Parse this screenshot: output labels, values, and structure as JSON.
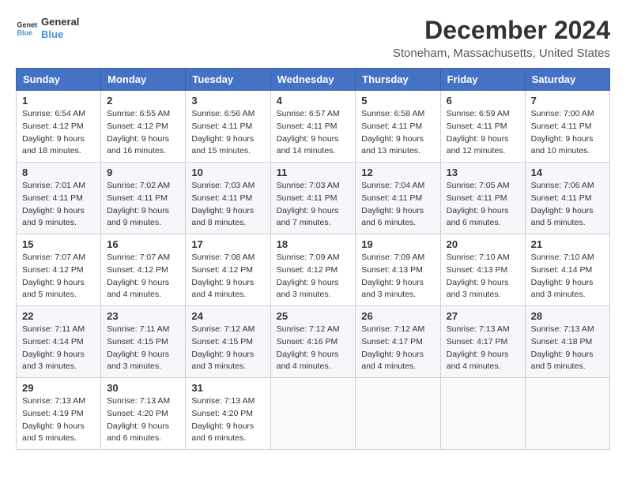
{
  "logo": {
    "line1": "General",
    "line2": "Blue"
  },
  "title": "December 2024",
  "subtitle": "Stoneham, Massachusetts, United States",
  "days_header": [
    "Sunday",
    "Monday",
    "Tuesday",
    "Wednesday",
    "Thursday",
    "Friday",
    "Saturday"
  ],
  "weeks": [
    [
      {
        "day": "1",
        "sunrise": "6:54 AM",
        "sunset": "4:12 PM",
        "daylight": "9 hours and 18 minutes."
      },
      {
        "day": "2",
        "sunrise": "6:55 AM",
        "sunset": "4:12 PM",
        "daylight": "9 hours and 16 minutes."
      },
      {
        "day": "3",
        "sunrise": "6:56 AM",
        "sunset": "4:11 PM",
        "daylight": "9 hours and 15 minutes."
      },
      {
        "day": "4",
        "sunrise": "6:57 AM",
        "sunset": "4:11 PM",
        "daylight": "9 hours and 14 minutes."
      },
      {
        "day": "5",
        "sunrise": "6:58 AM",
        "sunset": "4:11 PM",
        "daylight": "9 hours and 13 minutes."
      },
      {
        "day": "6",
        "sunrise": "6:59 AM",
        "sunset": "4:11 PM",
        "daylight": "9 hours and 12 minutes."
      },
      {
        "day": "7",
        "sunrise": "7:00 AM",
        "sunset": "4:11 PM",
        "daylight": "9 hours and 10 minutes."
      }
    ],
    [
      {
        "day": "8",
        "sunrise": "7:01 AM",
        "sunset": "4:11 PM",
        "daylight": "9 hours and 9 minutes."
      },
      {
        "day": "9",
        "sunrise": "7:02 AM",
        "sunset": "4:11 PM",
        "daylight": "9 hours and 9 minutes."
      },
      {
        "day": "10",
        "sunrise": "7:03 AM",
        "sunset": "4:11 PM",
        "daylight": "9 hours and 8 minutes."
      },
      {
        "day": "11",
        "sunrise": "7:03 AM",
        "sunset": "4:11 PM",
        "daylight": "9 hours and 7 minutes."
      },
      {
        "day": "12",
        "sunrise": "7:04 AM",
        "sunset": "4:11 PM",
        "daylight": "9 hours and 6 minutes."
      },
      {
        "day": "13",
        "sunrise": "7:05 AM",
        "sunset": "4:11 PM",
        "daylight": "9 hours and 6 minutes."
      },
      {
        "day": "14",
        "sunrise": "7:06 AM",
        "sunset": "4:11 PM",
        "daylight": "9 hours and 5 minutes."
      }
    ],
    [
      {
        "day": "15",
        "sunrise": "7:07 AM",
        "sunset": "4:12 PM",
        "daylight": "9 hours and 5 minutes."
      },
      {
        "day": "16",
        "sunrise": "7:07 AM",
        "sunset": "4:12 PM",
        "daylight": "9 hours and 4 minutes."
      },
      {
        "day": "17",
        "sunrise": "7:08 AM",
        "sunset": "4:12 PM",
        "daylight": "9 hours and 4 minutes."
      },
      {
        "day": "18",
        "sunrise": "7:09 AM",
        "sunset": "4:12 PM",
        "daylight": "9 hours and 3 minutes."
      },
      {
        "day": "19",
        "sunrise": "7:09 AM",
        "sunset": "4:13 PM",
        "daylight": "9 hours and 3 minutes."
      },
      {
        "day": "20",
        "sunrise": "7:10 AM",
        "sunset": "4:13 PM",
        "daylight": "9 hours and 3 minutes."
      },
      {
        "day": "21",
        "sunrise": "7:10 AM",
        "sunset": "4:14 PM",
        "daylight": "9 hours and 3 minutes."
      }
    ],
    [
      {
        "day": "22",
        "sunrise": "7:11 AM",
        "sunset": "4:14 PM",
        "daylight": "9 hours and 3 minutes."
      },
      {
        "day": "23",
        "sunrise": "7:11 AM",
        "sunset": "4:15 PM",
        "daylight": "9 hours and 3 minutes."
      },
      {
        "day": "24",
        "sunrise": "7:12 AM",
        "sunset": "4:15 PM",
        "daylight": "9 hours and 3 minutes."
      },
      {
        "day": "25",
        "sunrise": "7:12 AM",
        "sunset": "4:16 PM",
        "daylight": "9 hours and 4 minutes."
      },
      {
        "day": "26",
        "sunrise": "7:12 AM",
        "sunset": "4:17 PM",
        "daylight": "9 hours and 4 minutes."
      },
      {
        "day": "27",
        "sunrise": "7:13 AM",
        "sunset": "4:17 PM",
        "daylight": "9 hours and 4 minutes."
      },
      {
        "day": "28",
        "sunrise": "7:13 AM",
        "sunset": "4:18 PM",
        "daylight": "9 hours and 5 minutes."
      }
    ],
    [
      {
        "day": "29",
        "sunrise": "7:13 AM",
        "sunset": "4:19 PM",
        "daylight": "9 hours and 5 minutes."
      },
      {
        "day": "30",
        "sunrise": "7:13 AM",
        "sunset": "4:20 PM",
        "daylight": "9 hours and 6 minutes."
      },
      {
        "day": "31",
        "sunrise": "7:13 AM",
        "sunset": "4:20 PM",
        "daylight": "9 hours and 6 minutes."
      },
      null,
      null,
      null,
      null
    ]
  ]
}
